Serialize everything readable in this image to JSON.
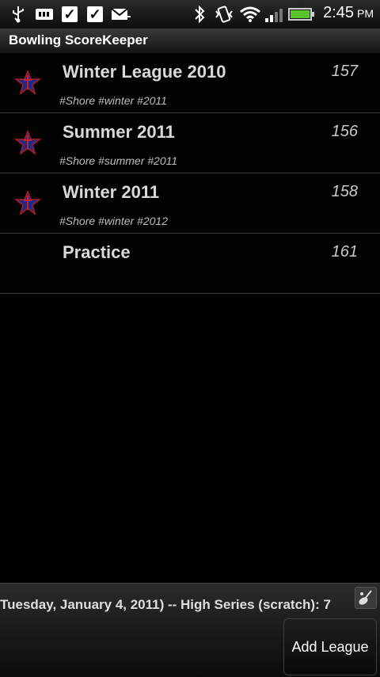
{
  "status_bar": {
    "time": "2:45",
    "ampm": "PM",
    "icons": [
      "usb-icon",
      "sd-card-icon",
      "check-icon",
      "check-icon",
      "mail-icon",
      "bluetooth-icon",
      "vibrate-icon",
      "wifi-icon",
      "signal-icon",
      "battery-icon"
    ],
    "accent_battery": "#4caf2a"
  },
  "app": {
    "title": "Bowling ScoreKeeper"
  },
  "leagues": [
    {
      "name": "Winter League 2010",
      "score": "157",
      "tags": "#Shore #winter #2011",
      "icon": "star-icon"
    },
    {
      "name": "Summer 2011",
      "score": "156",
      "tags": "#Shore #summer #2011",
      "icon": "star-icon"
    },
    {
      "name": "Winter 2011",
      "score": "158",
      "tags": "#Shore #winter #2012",
      "icon": "star-icon"
    },
    {
      "name": "Practice",
      "score": "161",
      "tags": "",
      "icon": ""
    }
  ],
  "footer": {
    "ticker": "Tuesday, January 4, 2011)  -- High Series (scratch): 7",
    "add_label": "Add League"
  }
}
